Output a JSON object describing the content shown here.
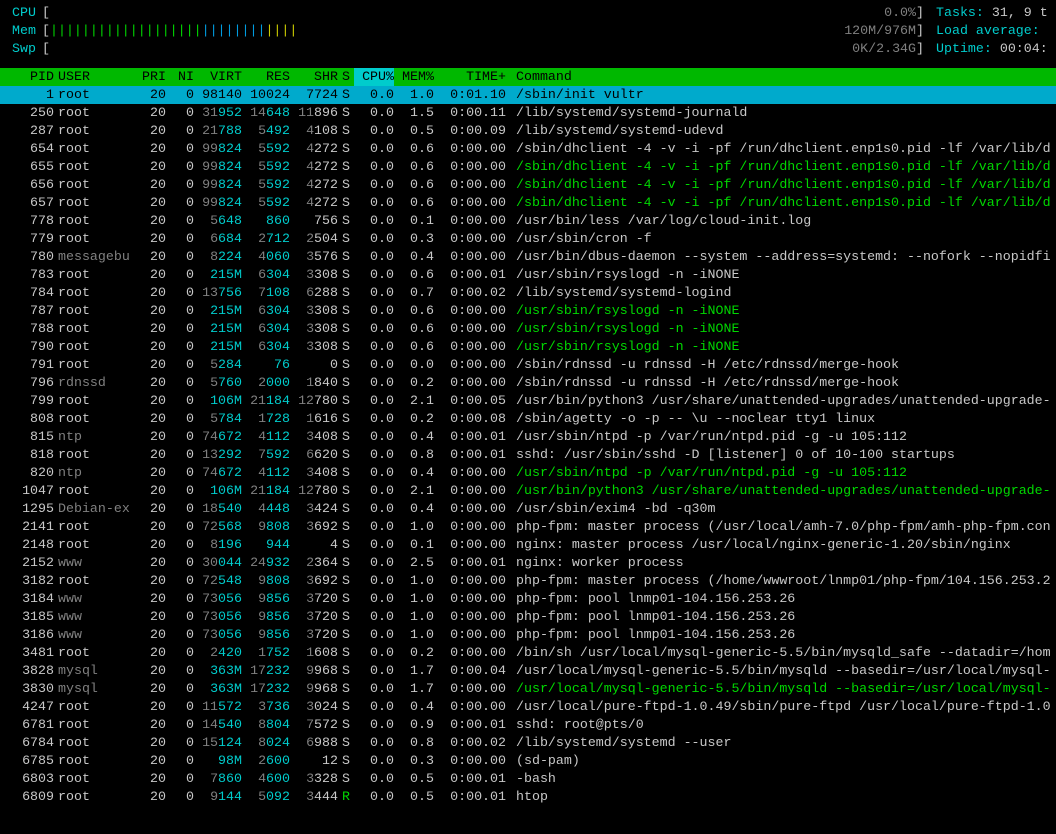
{
  "meters": {
    "cpu": {
      "label": "CPU",
      "bar": "",
      "value": "0.0%"
    },
    "mem": {
      "label": "Mem",
      "bar_green": "|||||||||||||||||||",
      "bar_blue": "||||||||",
      "bar_yellow": "||||",
      "value": "120M/976M"
    },
    "swp": {
      "label": "Swp",
      "bar": "",
      "value": "0K/2.34G"
    }
  },
  "info": {
    "tasks_label": "Tasks: ",
    "tasks_val": "31, 9 t",
    "load_label": "Load average:",
    "uptime_label": "Uptime: ",
    "uptime_val": "00:04:"
  },
  "header": {
    "pid": "PID",
    "user": "USER",
    "pri": "PRI",
    "ni": "NI",
    "virt": "VIRT",
    "res": "RES",
    "shr": "SHR",
    "s": "S",
    "cpu": "CPU%",
    "mem": "MEM%",
    "time": "TIME+",
    "cmd": "Command"
  },
  "rows": [
    {
      "pid": "1",
      "user": "root",
      "pri": "20",
      "ni": "0",
      "virt": "98140",
      "res": "10024",
      "shr": "7724",
      "s": "S",
      "cpu": "0.0",
      "mem": "1.0",
      "time": "0:01.10",
      "cmd": "/sbin/init vultr",
      "sel": true
    },
    {
      "pid": "250",
      "user": "root",
      "pri": "20",
      "ni": "0",
      "virt": "31952",
      "res": "14648",
      "shr": "11896",
      "s": "S",
      "cpu": "0.0",
      "mem": "1.5",
      "time": "0:00.11",
      "cmd": "/lib/systemd/systemd-journald"
    },
    {
      "pid": "287",
      "user": "root",
      "pri": "20",
      "ni": "0",
      "virt": "21788",
      "res": "5492",
      "shr": "4108",
      "s": "S",
      "cpu": "0.0",
      "mem": "0.5",
      "time": "0:00.09",
      "cmd": "/lib/systemd/systemd-udevd"
    },
    {
      "pid": "654",
      "user": "root",
      "pri": "20",
      "ni": "0",
      "virt": "99824",
      "res": "5592",
      "shr": "4272",
      "s": "S",
      "cpu": "0.0",
      "mem": "0.6",
      "time": "0:00.00",
      "cmd": "/sbin/dhclient -4 -v -i -pf /run/dhclient.enp1s0.pid -lf /var/lib/d"
    },
    {
      "pid": "655",
      "user": "root",
      "pri": "20",
      "ni": "0",
      "virt": "99824",
      "res": "5592",
      "shr": "4272",
      "s": "S",
      "cpu": "0.0",
      "mem": "0.6",
      "time": "0:00.00",
      "cmd": "/sbin/dhclient -4 -v -i -pf /run/dhclient.enp1s0.pid -lf /var/lib/d",
      "g": true
    },
    {
      "pid": "656",
      "user": "root",
      "pri": "20",
      "ni": "0",
      "virt": "99824",
      "res": "5592",
      "shr": "4272",
      "s": "S",
      "cpu": "0.0",
      "mem": "0.6",
      "time": "0:00.00",
      "cmd": "/sbin/dhclient -4 -v -i -pf /run/dhclient.enp1s0.pid -lf /var/lib/d",
      "g": true
    },
    {
      "pid": "657",
      "user": "root",
      "pri": "20",
      "ni": "0",
      "virt": "99824",
      "res": "5592",
      "shr": "4272",
      "s": "S",
      "cpu": "0.0",
      "mem": "0.6",
      "time": "0:00.00",
      "cmd": "/sbin/dhclient -4 -v -i -pf /run/dhclient.enp1s0.pid -lf /var/lib/d",
      "g": true
    },
    {
      "pid": "778",
      "user": "root",
      "pri": "20",
      "ni": "0",
      "virt": "5648",
      "res": "860",
      "shr": "756",
      "s": "S",
      "cpu": "0.0",
      "mem": "0.1",
      "time": "0:00.00",
      "cmd": "/usr/bin/less /var/log/cloud-init.log"
    },
    {
      "pid": "779",
      "user": "root",
      "pri": "20",
      "ni": "0",
      "virt": "6684",
      "res": "2712",
      "shr": "2504",
      "s": "S",
      "cpu": "0.0",
      "mem": "0.3",
      "time": "0:00.00",
      "cmd": "/usr/sbin/cron -f"
    },
    {
      "pid": "780",
      "user": "messagebu",
      "pri": "20",
      "ni": "0",
      "virt": "8224",
      "res": "4060",
      "shr": "3576",
      "s": "S",
      "cpu": "0.0",
      "mem": "0.4",
      "time": "0:00.00",
      "cmd": "/usr/bin/dbus-daemon --system --address=systemd: --nofork --nopidfi"
    },
    {
      "pid": "783",
      "user": "root",
      "pri": "20",
      "ni": "0",
      "virt": "215M",
      "res": "6304",
      "shr": "3308",
      "s": "S",
      "cpu": "0.0",
      "mem": "0.6",
      "time": "0:00.01",
      "cmd": "/usr/sbin/rsyslogd -n -iNONE"
    },
    {
      "pid": "784",
      "user": "root",
      "pri": "20",
      "ni": "0",
      "virt": "13756",
      "res": "7108",
      "shr": "6288",
      "s": "S",
      "cpu": "0.0",
      "mem": "0.7",
      "time": "0:00.02",
      "cmd": "/lib/systemd/systemd-logind"
    },
    {
      "pid": "787",
      "user": "root",
      "pri": "20",
      "ni": "0",
      "virt": "215M",
      "res": "6304",
      "shr": "3308",
      "s": "S",
      "cpu": "0.0",
      "mem": "0.6",
      "time": "0:00.00",
      "cmd": "/usr/sbin/rsyslogd -n -iNONE",
      "g": true
    },
    {
      "pid": "788",
      "user": "root",
      "pri": "20",
      "ni": "0",
      "virt": "215M",
      "res": "6304",
      "shr": "3308",
      "s": "S",
      "cpu": "0.0",
      "mem": "0.6",
      "time": "0:00.00",
      "cmd": "/usr/sbin/rsyslogd -n -iNONE",
      "g": true
    },
    {
      "pid": "790",
      "user": "root",
      "pri": "20",
      "ni": "0",
      "virt": "215M",
      "res": "6304",
      "shr": "3308",
      "s": "S",
      "cpu": "0.0",
      "mem": "0.6",
      "time": "0:00.00",
      "cmd": "/usr/sbin/rsyslogd -n -iNONE",
      "g": true
    },
    {
      "pid": "791",
      "user": "root",
      "pri": "20",
      "ni": "0",
      "virt": "5284",
      "res": "76",
      "shr": "0",
      "s": "S",
      "cpu": "0.0",
      "mem": "0.0",
      "time": "0:00.00",
      "cmd": "/sbin/rdnssd -u rdnssd -H /etc/rdnssd/merge-hook"
    },
    {
      "pid": "796",
      "user": "rdnssd",
      "pri": "20",
      "ni": "0",
      "virt": "5760",
      "res": "2000",
      "shr": "1840",
      "s": "S",
      "cpu": "0.0",
      "mem": "0.2",
      "time": "0:00.00",
      "cmd": "/sbin/rdnssd -u rdnssd -H /etc/rdnssd/merge-hook"
    },
    {
      "pid": "799",
      "user": "root",
      "pri": "20",
      "ni": "0",
      "virt": "106M",
      "res": "21184",
      "shr": "12780",
      "s": "S",
      "cpu": "0.0",
      "mem": "2.1",
      "time": "0:00.05",
      "cmd": "/usr/bin/python3 /usr/share/unattended-upgrades/unattended-upgrade-"
    },
    {
      "pid": "808",
      "user": "root",
      "pri": "20",
      "ni": "0",
      "virt": "5784",
      "res": "1728",
      "shr": "1616",
      "s": "S",
      "cpu": "0.0",
      "mem": "0.2",
      "time": "0:00.08",
      "cmd": "/sbin/agetty -o -p -- \\u --noclear tty1 linux"
    },
    {
      "pid": "815",
      "user": "ntp",
      "pri": "20",
      "ni": "0",
      "virt": "74672",
      "res": "4112",
      "shr": "3408",
      "s": "S",
      "cpu": "0.0",
      "mem": "0.4",
      "time": "0:00.01",
      "cmd": "/usr/sbin/ntpd -p /var/run/ntpd.pid -g -u 105:112"
    },
    {
      "pid": "818",
      "user": "root",
      "pri": "20",
      "ni": "0",
      "virt": "13292",
      "res": "7592",
      "shr": "6620",
      "s": "S",
      "cpu": "0.0",
      "mem": "0.8",
      "time": "0:00.01",
      "cmd": "sshd: /usr/sbin/sshd -D [listener] 0 of 10-100 startups"
    },
    {
      "pid": "820",
      "user": "ntp",
      "pri": "20",
      "ni": "0",
      "virt": "74672",
      "res": "4112",
      "shr": "3408",
      "s": "S",
      "cpu": "0.0",
      "mem": "0.4",
      "time": "0:00.00",
      "cmd": "/usr/sbin/ntpd -p /var/run/ntpd.pid -g -u 105:112",
      "g": true
    },
    {
      "pid": "1047",
      "user": "root",
      "pri": "20",
      "ni": "0",
      "virt": "106M",
      "res": "21184",
      "shr": "12780",
      "s": "S",
      "cpu": "0.0",
      "mem": "2.1",
      "time": "0:00.00",
      "cmd": "/usr/bin/python3 /usr/share/unattended-upgrades/unattended-upgrade-",
      "g": true
    },
    {
      "pid": "1295",
      "user": "Debian-ex",
      "pri": "20",
      "ni": "0",
      "virt": "18540",
      "res": "4448",
      "shr": "3424",
      "s": "S",
      "cpu": "0.0",
      "mem": "0.4",
      "time": "0:00.00",
      "cmd": "/usr/sbin/exim4 -bd -q30m"
    },
    {
      "pid": "2141",
      "user": "root",
      "pri": "20",
      "ni": "0",
      "virt": "72568",
      "res": "9808",
      "shr": "3692",
      "s": "S",
      "cpu": "0.0",
      "mem": "1.0",
      "time": "0:00.00",
      "cmd": "php-fpm: master process (/usr/local/amh-7.0/php-fpm/amh-php-fpm.con"
    },
    {
      "pid": "2148",
      "user": "root",
      "pri": "20",
      "ni": "0",
      "virt": "8196",
      "res": "944",
      "shr": "4",
      "s": "S",
      "cpu": "0.0",
      "mem": "0.1",
      "time": "0:00.00",
      "cmd": "nginx: master process /usr/local/nginx-generic-1.20/sbin/nginx"
    },
    {
      "pid": "2152",
      "user": "www",
      "pri": "20",
      "ni": "0",
      "virt": "30044",
      "res": "24932",
      "shr": "2364",
      "s": "S",
      "cpu": "0.0",
      "mem": "2.5",
      "time": "0:00.01",
      "cmd": "nginx: worker process"
    },
    {
      "pid": "3182",
      "user": "root",
      "pri": "20",
      "ni": "0",
      "virt": "72548",
      "res": "9808",
      "shr": "3692",
      "s": "S",
      "cpu": "0.0",
      "mem": "1.0",
      "time": "0:00.00",
      "cmd": "php-fpm: master process (/home/wwwroot/lnmp01/php-fpm/104.156.253.2"
    },
    {
      "pid": "3184",
      "user": "www",
      "pri": "20",
      "ni": "0",
      "virt": "73056",
      "res": "9856",
      "shr": "3720",
      "s": "S",
      "cpu": "0.0",
      "mem": "1.0",
      "time": "0:00.00",
      "cmd": "php-fpm: pool lnmp01-104.156.253.26"
    },
    {
      "pid": "3185",
      "user": "www",
      "pri": "20",
      "ni": "0",
      "virt": "73056",
      "res": "9856",
      "shr": "3720",
      "s": "S",
      "cpu": "0.0",
      "mem": "1.0",
      "time": "0:00.00",
      "cmd": "php-fpm: pool lnmp01-104.156.253.26"
    },
    {
      "pid": "3186",
      "user": "www",
      "pri": "20",
      "ni": "0",
      "virt": "73056",
      "res": "9856",
      "shr": "3720",
      "s": "S",
      "cpu": "0.0",
      "mem": "1.0",
      "time": "0:00.00",
      "cmd": "php-fpm: pool lnmp01-104.156.253.26"
    },
    {
      "pid": "3481",
      "user": "root",
      "pri": "20",
      "ni": "0",
      "virt": "2420",
      "res": "1752",
      "shr": "1608",
      "s": "S",
      "cpu": "0.0",
      "mem": "0.2",
      "time": "0:00.00",
      "cmd": "/bin/sh /usr/local/mysql-generic-5.5/bin/mysqld_safe --datadir=/hom"
    },
    {
      "pid": "3828",
      "user": "mysql",
      "pri": "20",
      "ni": "0",
      "virt": "363M",
      "res": "17232",
      "shr": "9968",
      "s": "S",
      "cpu": "0.0",
      "mem": "1.7",
      "time": "0:00.04",
      "cmd": "/usr/local/mysql-generic-5.5/bin/mysqld --basedir=/usr/local/mysql-"
    },
    {
      "pid": "3830",
      "user": "mysql",
      "pri": "20",
      "ni": "0",
      "virt": "363M",
      "res": "17232",
      "shr": "9968",
      "s": "S",
      "cpu": "0.0",
      "mem": "1.7",
      "time": "0:00.00",
      "cmd": "/usr/local/mysql-generic-5.5/bin/mysqld --basedir=/usr/local/mysql-",
      "g": true
    },
    {
      "pid": "4247",
      "user": "root",
      "pri": "20",
      "ni": "0",
      "virt": "11572",
      "res": "3736",
      "shr": "3024",
      "s": "S",
      "cpu": "0.0",
      "mem": "0.4",
      "time": "0:00.00",
      "cmd": "/usr/local/pure-ftpd-1.0.49/sbin/pure-ftpd /usr/local/pure-ftpd-1.0"
    },
    {
      "pid": "6781",
      "user": "root",
      "pri": "20",
      "ni": "0",
      "virt": "14540",
      "res": "8804",
      "shr": "7572",
      "s": "S",
      "cpu": "0.0",
      "mem": "0.9",
      "time": "0:00.01",
      "cmd": "sshd: root@pts/0"
    },
    {
      "pid": "6784",
      "user": "root",
      "pri": "20",
      "ni": "0",
      "virt": "15124",
      "res": "8024",
      "shr": "6988",
      "s": "S",
      "cpu": "0.0",
      "mem": "0.8",
      "time": "0:00.02",
      "cmd": "/lib/systemd/systemd --user"
    },
    {
      "pid": "6785",
      "user": "root",
      "pri": "20",
      "ni": "0",
      "virt": "98M",
      "res": "2600",
      "shr": "12",
      "s": "S",
      "cpu": "0.0",
      "mem": "0.3",
      "time": "0:00.00",
      "cmd": "(sd-pam)"
    },
    {
      "pid": "6803",
      "user": "root",
      "pri": "20",
      "ni": "0",
      "virt": "7860",
      "res": "4600",
      "shr": "3328",
      "s": "S",
      "cpu": "0.0",
      "mem": "0.5",
      "time": "0:00.01",
      "cmd": "-bash"
    },
    {
      "pid": "6809",
      "user": "root",
      "pri": "20",
      "ni": "0",
      "virt": "9144",
      "res": "5092",
      "shr": "3444",
      "s": "R",
      "cpu": "0.0",
      "mem": "0.5",
      "time": "0:00.01",
      "cmd": "htop",
      "run": true
    }
  ]
}
